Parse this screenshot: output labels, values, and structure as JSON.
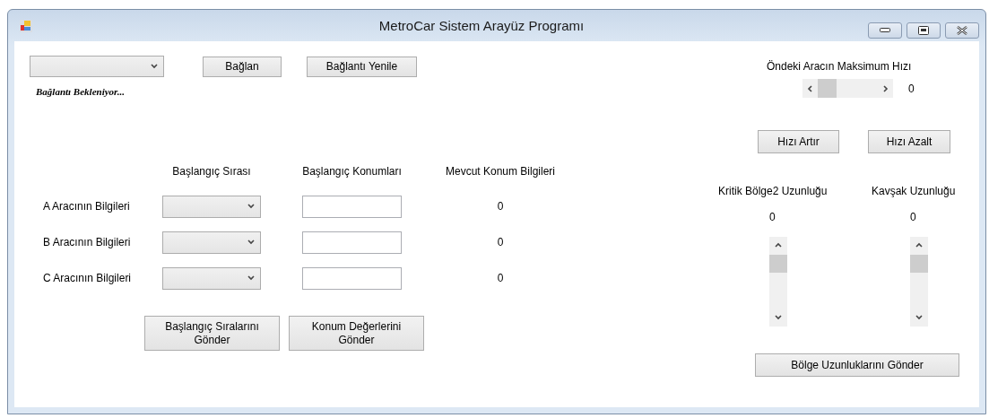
{
  "window": {
    "title": "MetroCar Sistem Arayüz Programı"
  },
  "connection": {
    "buttons": [
      "Bağlan",
      "Bağlantı Yenile"
    ],
    "status": "Bağlantı Bekleniyor..."
  },
  "vehicles": {
    "columns": [
      "Başlangıç Sırası",
      "Başlangıç Konumları",
      "Mevcut Konum Bilgileri"
    ],
    "rows": [
      {
        "label": "A Aracının Bilgileri",
        "current": "0"
      },
      {
        "label": "B Aracının Bilgileri",
        "current": "0"
      },
      {
        "label": "C Aracının Bilgileri",
        "current": "0"
      }
    ],
    "buttons": [
      "Başlangıç Sıralarını\nGönder",
      "Konum Değerlerini\nGönder"
    ]
  },
  "speed": {
    "label": "Öndeki Aracın Maksimum Hızı",
    "value": "0",
    "buttons": [
      "Hızı Artır",
      "Hızı Azalt"
    ]
  },
  "lengths": {
    "items": [
      {
        "label": "Kritik Bölge2 Uzunluğu",
        "value": "0"
      },
      {
        "label": "Kavşak Uzunluğu",
        "value": "0"
      }
    ],
    "button": "Bölge Uzunluklarını Gönder"
  }
}
